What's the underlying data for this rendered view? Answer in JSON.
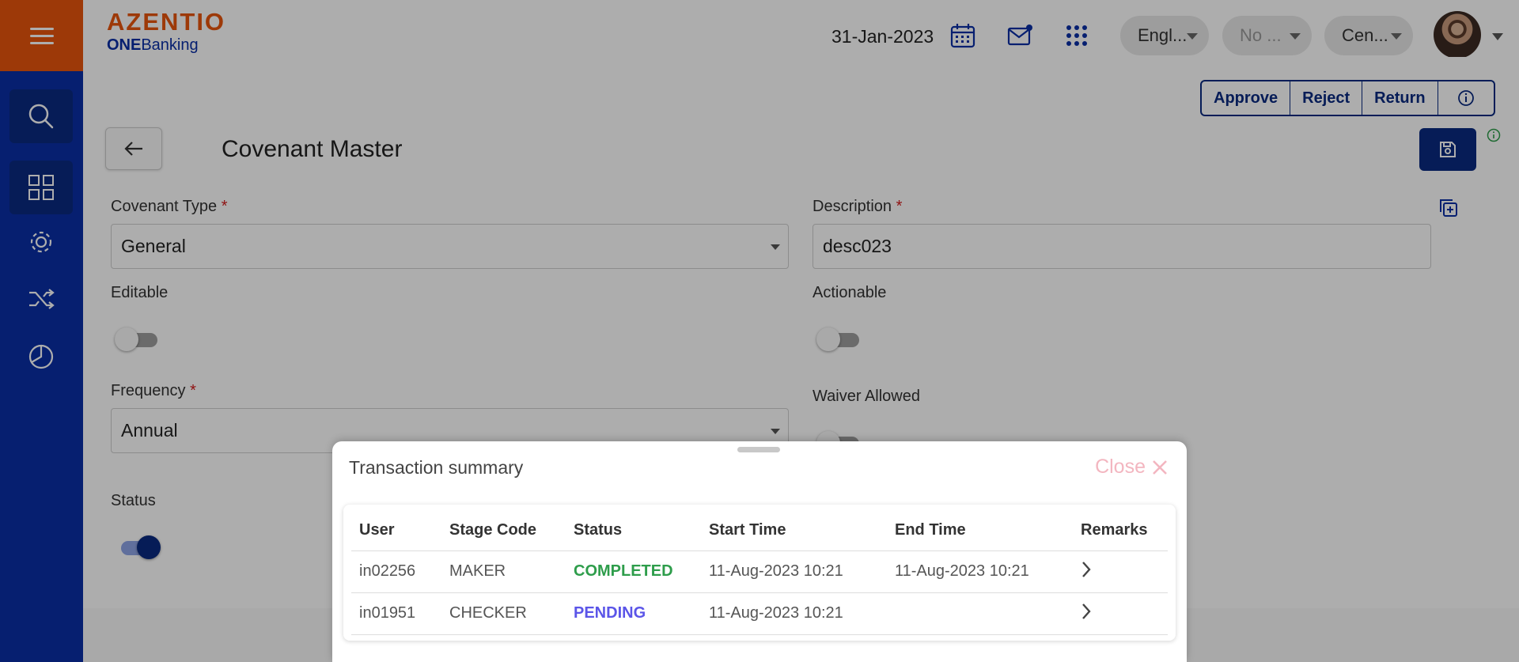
{
  "header": {
    "logo_brand": "AZENTIO",
    "logo_product_bold": "ONE",
    "logo_product_rest": "Banking",
    "date": "31-Jan-2023",
    "language_label": "Engl...",
    "pill2_label": "No ...",
    "pill3_label": "Cen..."
  },
  "sidebar": {
    "items": [
      {
        "icon": "search-icon"
      },
      {
        "icon": "dashboard-grid-icon"
      },
      {
        "icon": "gear-icon"
      },
      {
        "icon": "shuffle-icon"
      },
      {
        "icon": "pie-chart-icon"
      }
    ]
  },
  "actions": {
    "approve": "Approve",
    "reject": "Reject",
    "return": "Return"
  },
  "page": {
    "title": "Covenant Master"
  },
  "form": {
    "covenant_type_label": "Covenant Type",
    "covenant_type_value": "General",
    "description_label": "Description",
    "description_value": "desc023",
    "editable_label": "Editable",
    "actionable_label": "Actionable",
    "frequency_label": "Frequency",
    "frequency_value": "Annual",
    "waiver_label": "Waiver Allowed",
    "status_label": "Status",
    "required_mark": "*"
  },
  "summary": {
    "title": "Transaction summary",
    "close_label": "Close",
    "columns": [
      "User",
      "Stage Code",
      "Status",
      "Start Time",
      "End Time",
      "Remarks"
    ],
    "rows": [
      {
        "user": "in02256",
        "stage": "MAKER",
        "status": "COMPLETED",
        "start": "11-Aug-2023 10:21",
        "end": "11-Aug-2023 10:21"
      },
      {
        "user": "in01951",
        "stage": "CHECKER",
        "status": "PENDING",
        "start": "11-Aug-2023 10:21",
        "end": ""
      }
    ]
  },
  "colors": {
    "brand_orange": "#e8540c",
    "brand_blue": "#0a2ea6",
    "navy": "#0a2a80",
    "completed": "#2e9d4b",
    "pending": "#5b55e8"
  }
}
